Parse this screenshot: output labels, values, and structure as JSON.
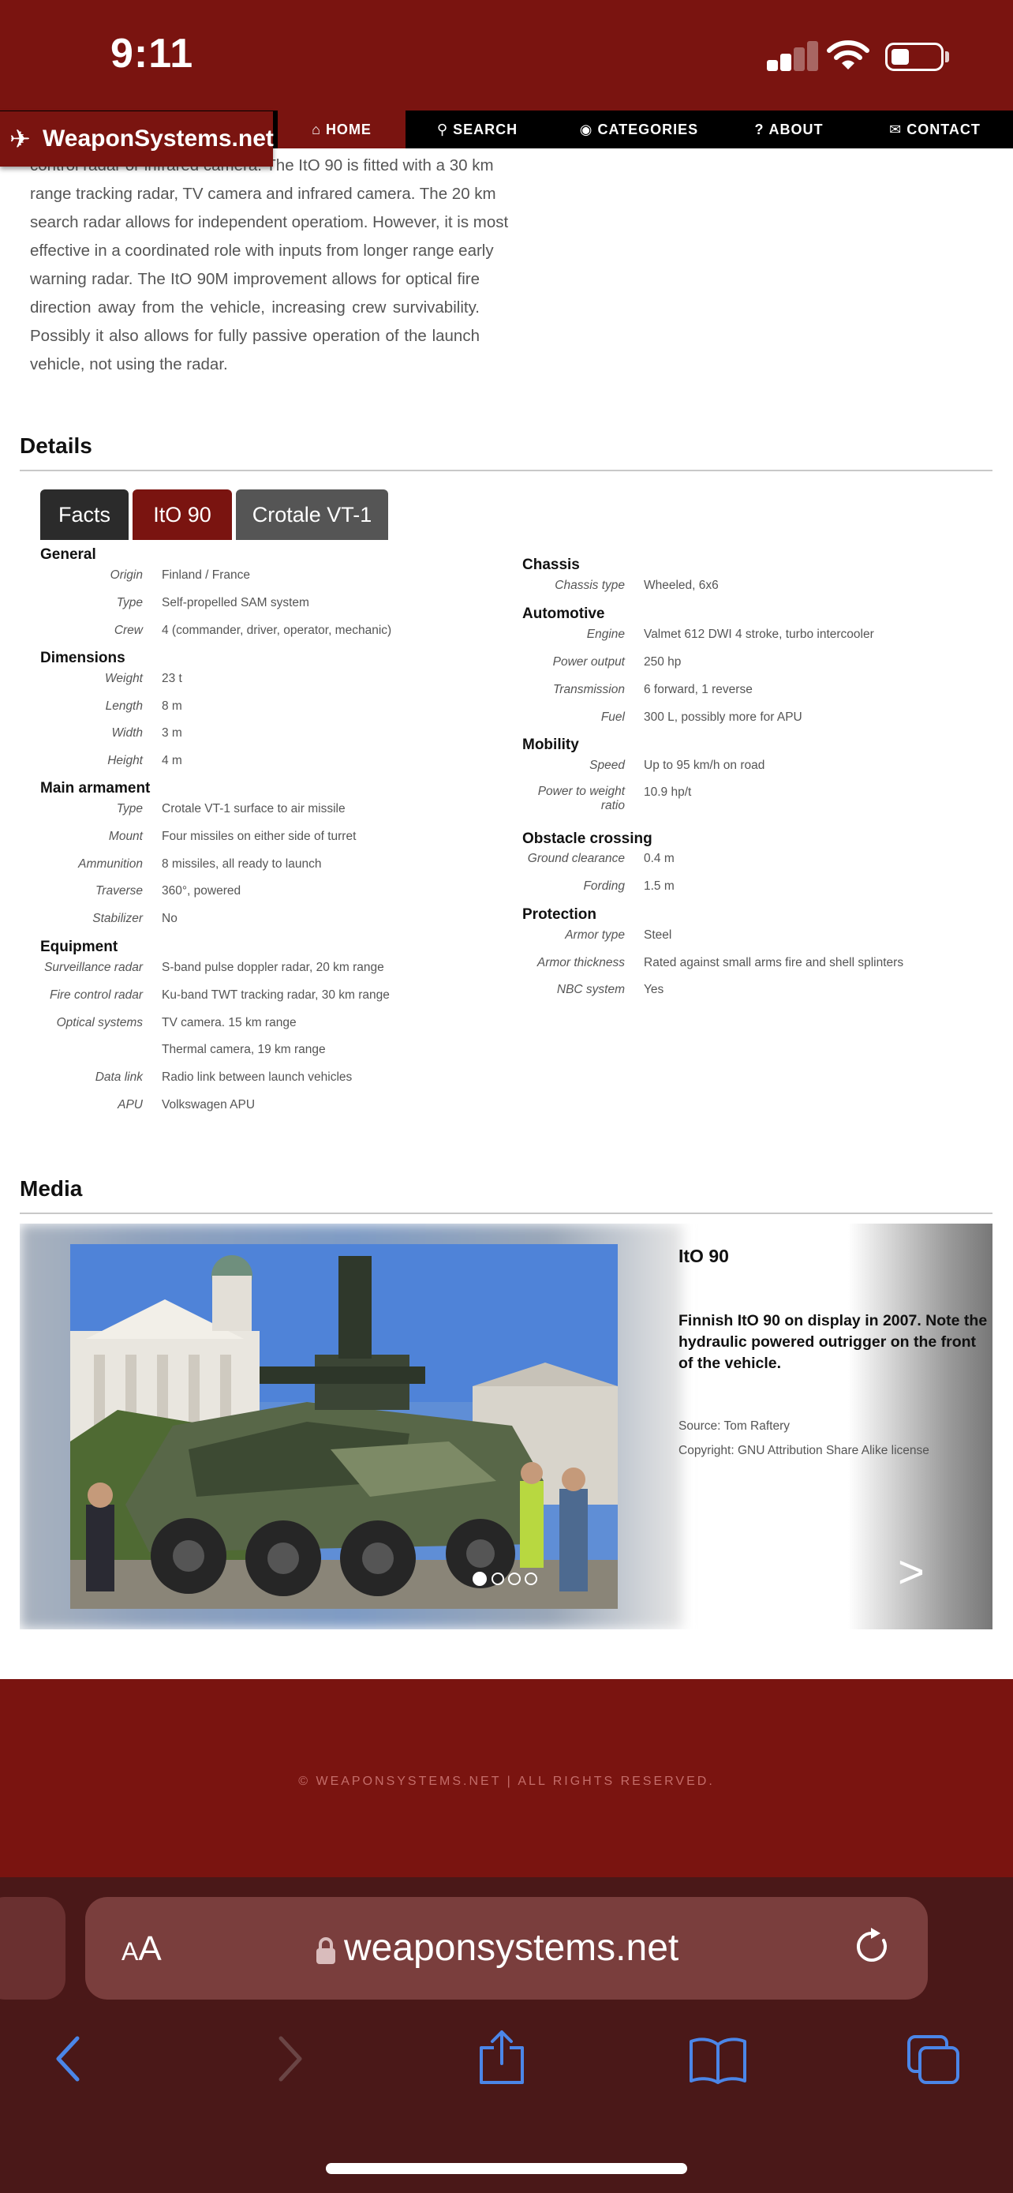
{
  "status_bar": {
    "time": "9:11"
  },
  "nav": {
    "logo": "WeaponSystems.net",
    "items": [
      {
        "label": "HOME",
        "icon": "home-icon"
      },
      {
        "label": "SEARCH",
        "icon": "search-icon"
      },
      {
        "label": "CATEGORIES",
        "icon": "globe-icon"
      },
      {
        "label": "ABOUT",
        "icon": "question-icon"
      },
      {
        "label": "CONTACT",
        "icon": "envelope-icon"
      }
    ]
  },
  "intro_lines": [
    "control radar or infrared camera. The ItO 90 is fitted with a 30 km",
    "range tracking radar, TV camera and infrared camera. The 20 km",
    "search radar allows for independent operatiom. However, it is most",
    "effective in a coordinated role with inputs from longer range early",
    "warning radar. The ItO 90M improvement allows for optical fire",
    "direction away from the vehicle, increasing crew survivability.",
    "Possibly it also allows for fully passive operation of the launch",
    "vehicle, not using the radar."
  ],
  "details": {
    "title": "Details",
    "tabs": [
      "Facts",
      "ItO 90",
      "Crotale VT-1"
    ],
    "left": [
      {
        "group": "General",
        "rows": [
          {
            "label": "Origin",
            "value": "Finland / France"
          },
          {
            "label": "Type",
            "value": "Self-propelled SAM system"
          },
          {
            "label": "Crew",
            "value": "4 (commander, driver, operator, mechanic)"
          }
        ]
      },
      {
        "group": "Dimensions",
        "rows": [
          {
            "label": "Weight",
            "value": "23 t"
          },
          {
            "label": "Length",
            "value": "8 m"
          },
          {
            "label": "Width",
            "value": "3 m"
          },
          {
            "label": "Height",
            "value": "4 m"
          }
        ]
      },
      {
        "group": "Main armament",
        "rows": [
          {
            "label": "Type",
            "value": "Crotale VT-1 surface to air missile"
          },
          {
            "label": "Mount",
            "value": "Four missiles on either side of turret"
          },
          {
            "label": "Ammunition",
            "value": "8 missiles, all ready to launch"
          },
          {
            "label": "Traverse",
            "value": "360°, powered"
          },
          {
            "label": "Stabilizer",
            "value": "No"
          }
        ]
      },
      {
        "group": "Equipment",
        "rows": [
          {
            "label": "Surveillance radar",
            "value": "S-band pulse doppler radar, 20 km range"
          },
          {
            "label": "Fire control radar",
            "value": "Ku-band TWT tracking radar, 30 km range"
          },
          {
            "label": "Optical systems",
            "value": "TV camera. 15 km range"
          },
          {
            "label": "",
            "value": "Thermal camera, 19 km range"
          },
          {
            "label": "Data link",
            "value": "Radio link between launch vehicles"
          },
          {
            "label": "APU",
            "value": "Volkswagen APU"
          }
        ]
      }
    ],
    "right": [
      {
        "group": "Chassis",
        "rows": [
          {
            "label": "Chassis type",
            "value": "Wheeled, 6x6"
          }
        ]
      },
      {
        "group": "Automotive",
        "rows": [
          {
            "label": "Engine",
            "value": "Valmet 612 DWI 4 stroke, turbo intercooler"
          },
          {
            "label": "Power output",
            "value": "250 hp"
          },
          {
            "label": "Transmission",
            "value": "6 forward, 1 reverse"
          },
          {
            "label": "Fuel",
            "value": "300 L, possibly more for APU"
          }
        ]
      },
      {
        "group": "Mobility",
        "rows": [
          {
            "label": "Speed",
            "value": "Up to 95 km/h on road"
          },
          {
            "label": "Power to weight ratio",
            "value": "10.9 hp/t"
          }
        ]
      },
      {
        "group": "Obstacle crossing",
        "rows": [
          {
            "label": "Ground clearance",
            "value": "0.4 m"
          },
          {
            "label": "Fording",
            "value": "1.5 m"
          }
        ]
      },
      {
        "group": "Protection",
        "rows": [
          {
            "label": "Armor type",
            "value": "Steel"
          },
          {
            "label": "Armor thickness",
            "value": "Rated against small arms fire and shell splinters"
          },
          {
            "label": "NBC system",
            "value": "Yes"
          }
        ]
      }
    ]
  },
  "media": {
    "title": "Media",
    "item_title": "ItO 90",
    "caption_lines": [
      "Finnish ItO 90 on display in 2007. Note the",
      "hydraulic powered outrigger on the front",
      "of the vehicle."
    ],
    "source": "Source: Tom Raftery",
    "copyright": "Copyright: GNU Attribution Share Alike license",
    "next": ">",
    "slides": 4,
    "active_slide": 1
  },
  "footer": {
    "text": "© WEAPONSYSTEMS.NET | ALL RIGHTS RESERVED."
  },
  "browser": {
    "aa_small": "A",
    "aa_big": "A",
    "url": "weaponsystems.net"
  },
  "colors": {
    "brand": "#7a1410",
    "nav": "#000000",
    "browser_chrome": "#4a1818",
    "toolbar_icon": "#4b86e8"
  }
}
